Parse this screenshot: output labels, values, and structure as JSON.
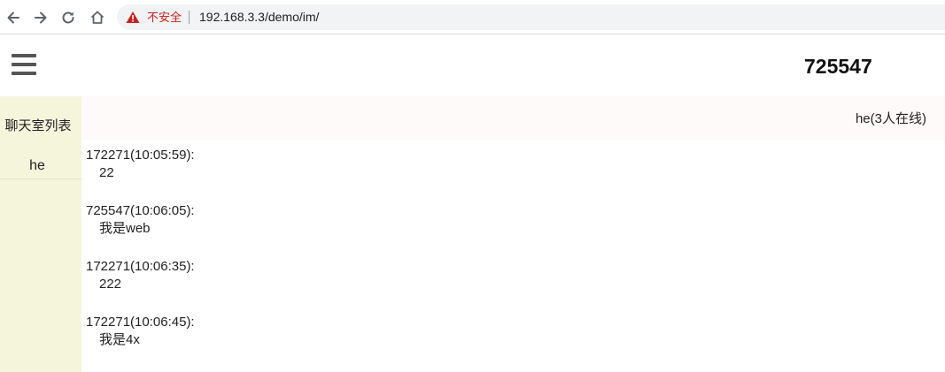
{
  "browser": {
    "security_label": "不安全",
    "url": "192.168.3.3/demo/im/"
  },
  "header": {
    "user_id": "725547"
  },
  "sidebar": {
    "title": "聊天室列表",
    "rooms": [
      {
        "label": "he"
      }
    ]
  },
  "chat": {
    "room_title": "he(3人在线)",
    "messages": [
      {
        "meta": "172271(10:05:59):",
        "text": "22"
      },
      {
        "meta": "725547(10:06:05):",
        "text": "我是web"
      },
      {
        "meta": "172271(10:06:35):",
        "text": "222"
      },
      {
        "meta": "172271(10:06:45):",
        "text": "我是4x"
      }
    ]
  }
}
